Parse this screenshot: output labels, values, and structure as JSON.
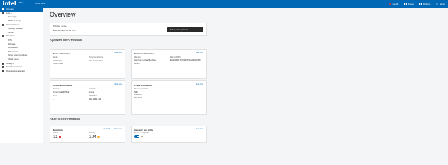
{
  "topbar": {
    "brand": "intel",
    "subtitle": "BMC",
    "subtitle2": "Server name",
    "health_label": "Health",
    "health_color": "#e0343b",
    "power_label": "Power",
    "refresh_label": "Refresh",
    "user_label": "admin"
  },
  "sidebar": {
    "items": [
      {
        "label": "Overview",
        "active": true
      },
      {
        "label": "Logs",
        "expanded": true
      },
      {
        "label": "Event logs",
        "sub": true
      },
      {
        "label": "POST code logs",
        "sub": true
      },
      {
        "label": "Hardware status",
        "expanded": true
      },
      {
        "label": "Inventory and LEDs",
        "sub": true
      },
      {
        "label": "Sensors",
        "sub": true
      },
      {
        "label": "Operations",
        "expanded": true
      },
      {
        "label": "KVM",
        "sub": true
      },
      {
        "label": "Firmware",
        "sub": true
      },
      {
        "label": "Reboot BMC",
        "sub": true
      },
      {
        "label": "SOL console",
        "sub": true
      },
      {
        "label": "Server power operations",
        "sub": true
      },
      {
        "label": "Virtual media",
        "sub": true
      },
      {
        "label": "Settings"
      },
      {
        "label": "Security and access"
      },
      {
        "label": "Resource management"
      }
    ]
  },
  "page": {
    "title": "Overview"
  },
  "bmc_card": {
    "time_label": "BMC date and time",
    "time_value": "2024-05-29 14:03:01 UTC",
    "power_button": "Server power operations"
  },
  "system_section": {
    "title": "System information"
  },
  "server_info": {
    "title": "Server information",
    "link": "View more",
    "model_label": "Model",
    "model_value": "ArcherCity",
    "manufacturer_label": "Server manufacturer",
    "manufacturer_value": "Intel Corporation",
    "serial_label": "Serial number",
    "serial_value": "--"
  },
  "firmware_info": {
    "title": "Firmware information",
    "link": "View more",
    "running_label": "Running",
    "running_value": "bmc-0x1F-1-g6bee9fb-30beec",
    "bios_label": "Running BIOS",
    "bios_value": "EGSDCRB1.SYS.0021.P23.2405221958",
    "bmc_label": "Backup",
    "bmc_value": "--"
  },
  "network_info": {
    "title": "Network information",
    "link": "View more",
    "hostname_label": "Hostname",
    "hostname_value": "bmc-mbeab4f76a3",
    "link_label": "Link status",
    "link_value": "Linkup",
    "ipv4_label": "IPv4",
    "ipv4_value": "--",
    "dhcp_label": "DHCP IPv4",
    "dhcp_value": "192.168.1.111"
  },
  "power_info": {
    "title": "Power information",
    "link": "View more",
    "consumption_label": "Power consumption",
    "consumption_value": "",
    "cap_label": "Power cap",
    "cap_value": "Disabled",
    "extra_value": "N/D"
  },
  "status_section": {
    "title": "Status information"
  },
  "event_logs": {
    "title": "Event logs",
    "link1": "Clear all",
    "link2": "View more",
    "critical_label": "Critical",
    "critical_value": "11",
    "critical_color": "#e0343b",
    "warning_label": "Warning",
    "warning_value": "104",
    "warning_color": "#f5a623"
  },
  "inventory_leds": {
    "title": "Inventory and LEDs",
    "link": "View more",
    "indicator_label": "System identify LED",
    "indicator_value": "Off"
  }
}
